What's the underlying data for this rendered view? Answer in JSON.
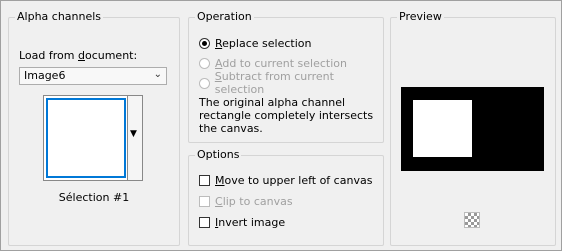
{
  "alpha_channels": {
    "title": "Alpha channels",
    "load_label_pre": "Load from ",
    "load_label_u": "d",
    "load_label_post": "ocument:",
    "document_selected": "Image6",
    "channel_caption": "Sélection #1"
  },
  "operation": {
    "title": "Operation",
    "options": [
      {
        "u": "R",
        "rest": "eplace selection",
        "selected": true,
        "enabled": true
      },
      {
        "u": "A",
        "rest": "dd to current selection",
        "selected": false,
        "enabled": false
      },
      {
        "u": "S",
        "rest": "ubtract from current selection",
        "selected": false,
        "enabled": false
      }
    ],
    "description": "The original alpha channel rectangle completely intersects the canvas."
  },
  "options": {
    "title": "Options",
    "checks": [
      {
        "u": "M",
        "rest": "ove to upper left of canvas",
        "checked": false,
        "enabled": true
      },
      {
        "u": "C",
        "rest": "lip to canvas",
        "checked": false,
        "enabled": false
      },
      {
        "u": "I",
        "rest": "nvert image",
        "checked": false,
        "enabled": true
      }
    ]
  },
  "preview": {
    "title": "Preview"
  }
}
